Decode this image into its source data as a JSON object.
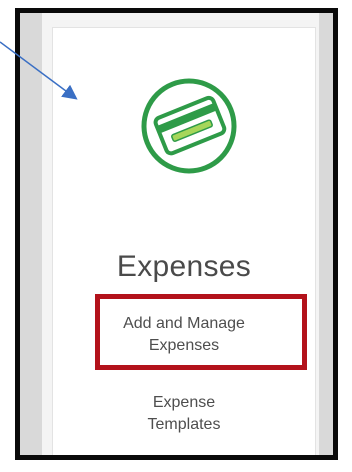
{
  "card": {
    "title": "Expenses",
    "icon": "credit-card-icon",
    "links": [
      {
        "line1": "Add and Manage",
        "line2": "Expenses",
        "highlighted": true
      },
      {
        "line1": "Expense",
        "line2": "Templates",
        "highlighted": false
      }
    ]
  },
  "colors": {
    "icon_green": "#2e9b48",
    "icon_light_green": "#a6d65a",
    "highlight_red": "#b3121b",
    "arrow_blue": "#3a6fc4",
    "frame_black": "#0a0a0a"
  },
  "annotation": {
    "arrow": "callout-arrow"
  }
}
